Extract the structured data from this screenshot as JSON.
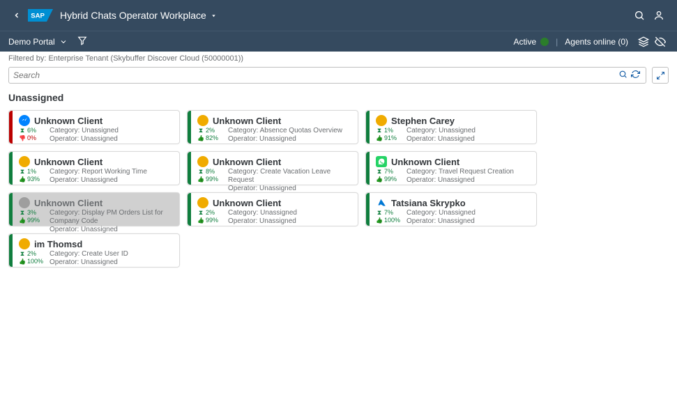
{
  "colors": {
    "accent": "#f0ab00",
    "shell": "#354a5f",
    "green": "#107e3e",
    "red": "#bb0000"
  },
  "shell": {
    "back_icon": "chevron-left",
    "logo_text": "SAP",
    "title": "Hybrid Chats Operator Workplace"
  },
  "subbar": {
    "portal": "Demo Portal",
    "filter_icon": "funnel",
    "status_label": "Active",
    "agents_label": "Agents online (0)",
    "layers_icon": "layers",
    "eyeoff_icon": "eye-off"
  },
  "filterby": "Filtered by: Enterprise Tenant (Skybuffer Discover Cloud (50000001))",
  "search": {
    "placeholder": "Search",
    "search_icon": "search",
    "refresh_icon": "refresh",
    "expand_icon": "expand"
  },
  "section_title": "Unassigned",
  "cards": [
    {
      "stripe": "#bb0000",
      "channel": "messenger",
      "name": "Unknown Client",
      "stat1": {
        "icon": "hourglass",
        "cls": "green",
        "val": "6%"
      },
      "stat2": {
        "icon": "thumbdown",
        "cls": "red",
        "val": "0%"
      },
      "category": "Unassigned",
      "operator": "Unassigned"
    },
    {
      "stripe": "#107e3e",
      "channel": "bubble",
      "name": "Unknown Client",
      "stat1": {
        "icon": "hourglass",
        "cls": "green",
        "val": "2%"
      },
      "stat2": {
        "icon": "thumb",
        "cls": "green",
        "val": "82%"
      },
      "category": "Absence Quotas Overview",
      "operator": "Unassigned"
    },
    {
      "stripe": "#107e3e",
      "channel": "bubble",
      "name": "Stephen Carey",
      "stat1": {
        "icon": "hourglass",
        "cls": "green",
        "val": "1%"
      },
      "stat2": {
        "icon": "thumb",
        "cls": "green",
        "val": "91%"
      },
      "category": "Unassigned",
      "operator": "Unassigned"
    },
    {
      "stripe": "#107e3e",
      "channel": "bubble",
      "name": "Unknown Client",
      "stat1": {
        "icon": "hourglass",
        "cls": "green",
        "val": "1%"
      },
      "stat2": {
        "icon": "thumb",
        "cls": "green",
        "val": "93%"
      },
      "category": "Report Working Time",
      "operator": "Unassigned"
    },
    {
      "stripe": "#107e3e",
      "channel": "bubble",
      "name": "Unknown Client",
      "stat1": {
        "icon": "hourglass",
        "cls": "green",
        "val": "8%"
      },
      "stat2": {
        "icon": "thumb",
        "cls": "green",
        "val": "99%"
      },
      "category": "Create Vacation Leave Request",
      "operator": "Unassigned"
    },
    {
      "stripe": "#107e3e",
      "channel": "whatsapp",
      "name": "Unknown Client",
      "stat1": {
        "icon": "hourglass",
        "cls": "green",
        "val": "7%"
      },
      "stat2": {
        "icon": "thumb",
        "cls": "green",
        "val": "99%"
      },
      "category": "Travel Request Creation",
      "operator": "Unassigned"
    },
    {
      "stripe": "#107e3e",
      "channel": "bubble-gray",
      "name": "Unknown Client",
      "selected": true,
      "stat1": {
        "icon": "hourglass",
        "cls": "green",
        "val": "3%"
      },
      "stat2": {
        "icon": "thumb",
        "cls": "green",
        "val": "99%"
      },
      "category": "Display PM Orders List for Company Code",
      "operator": "Unassigned"
    },
    {
      "stripe": "#107e3e",
      "channel": "bubble",
      "name": "Unknown Client",
      "stat1": {
        "icon": "hourglass",
        "cls": "green",
        "val": "2%"
      },
      "stat2": {
        "icon": "thumb",
        "cls": "green",
        "val": "99%"
      },
      "category": "Unassigned",
      "operator": "Unassigned"
    },
    {
      "stripe": "#107e3e",
      "channel": "azure",
      "name": "Tatsiana Skrypko",
      "stat1": {
        "icon": "hourglass",
        "cls": "green",
        "val": "7%"
      },
      "stat2": {
        "icon": "thumb",
        "cls": "green",
        "val": "100%"
      },
      "category": "Unassigned",
      "operator": "Unassigned"
    },
    {
      "stripe": "#107e3e",
      "channel": "bubble",
      "name": "im Thomsd",
      "stat1": {
        "icon": "hourglass",
        "cls": "green",
        "val": "2%"
      },
      "stat2": {
        "icon": "thumb",
        "cls": "green",
        "val": "100%"
      },
      "category": "Create User ID",
      "operator": "Unassigned"
    }
  ],
  "labels": {
    "category_prefix": "Category: ",
    "operator_prefix": "Operator: "
  }
}
